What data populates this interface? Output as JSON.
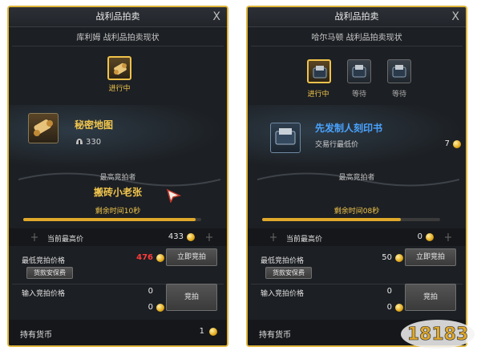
{
  "panels": [
    {
      "title": "战利品拍卖",
      "close_label": "X",
      "subtitle": "库利姆 战利品拍卖现状",
      "slots": [
        {
          "state_label": "进行中",
          "icon": "scroll-icon"
        }
      ],
      "item": {
        "name": "秘密地图",
        "stat_value": "330",
        "stat_icon": "helmet-icon"
      },
      "bidder_title": "最高竞拍者",
      "bidder_name": "搬砖小老张",
      "remaining": "剩余时间10秒",
      "progress": 0.97,
      "current_high_label": "当前最高价",
      "current_high_value": "433",
      "min_bid_label": "最低竞拍价格",
      "min_bid_value": "476",
      "guarantee_button": "货款安保费",
      "instant_button": "立即竞拍",
      "input_label": "输入竞拍价格",
      "input_value": "0",
      "input_coin_value": "0",
      "bid_button": "竞拍",
      "holding_label": "持有货币",
      "holding_value": "1"
    },
    {
      "title": "战利品拍卖",
      "close_label": "X",
      "subtitle": "哈尔马顿 战利品拍卖现状",
      "slots": [
        {
          "state_label": "进行中",
          "icon": "seal-box-icon"
        },
        {
          "state_label": "等待",
          "icon": "seal-box-icon"
        },
        {
          "state_label": "等待",
          "icon": "seal-box-icon"
        }
      ],
      "item": {
        "name": "先发制人刻印书",
        "sub_label": "交易行最低价",
        "sub_value": "7"
      },
      "bidder_title": "最高竞拍者",
      "bidder_name": "",
      "remaining": "剩余时间08秒",
      "progress": 0.78,
      "current_high_label": "当前最高价",
      "current_high_value": "0",
      "min_bid_label": "最低竞拍价格",
      "min_bid_value": "50",
      "guarantee_button": "货款安保费",
      "instant_button": "立即竞拍",
      "input_label": "输入竞拍价格",
      "input_value": "0",
      "input_coin_value": "0",
      "bid_button": "竞拍",
      "holding_label": "持有货币",
      "holding_value": ""
    }
  ],
  "watermark": "18183",
  "colors": {
    "border": "#e0b63c",
    "accent": "#f2c64d",
    "item_name_left": "#f2c64d",
    "item_name_right": "#49a3ff",
    "min_bid_red": "#ff3b3b"
  }
}
